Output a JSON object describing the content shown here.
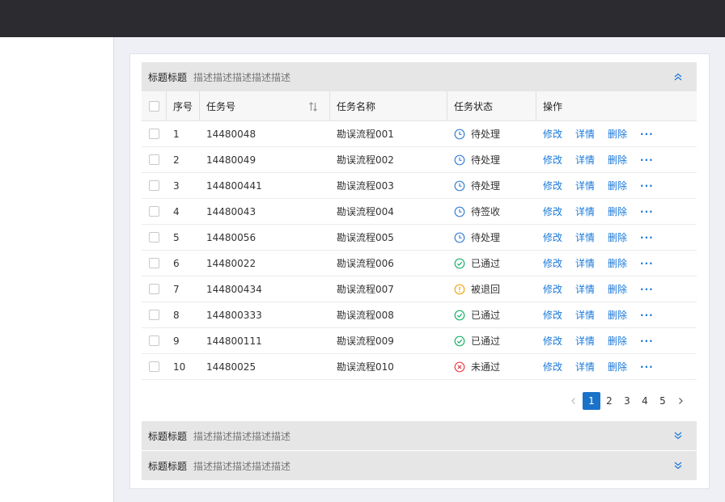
{
  "panels": [
    {
      "title": "标题标题",
      "desc": "描述描述描述描述描述",
      "expanded": true,
      "chevron": "chevron-double-up-icon"
    },
    {
      "title": "标题标题",
      "desc": "描述描述描述描述描述",
      "expanded": false,
      "chevron": "chevron-double-down-icon"
    },
    {
      "title": "标题标题",
      "desc": "描述描述描述描述描述",
      "expanded": false,
      "chevron": "chevron-double-down-icon"
    }
  ],
  "table": {
    "headers": {
      "index": "序号",
      "task_no": "任务号",
      "task_name": "任务名称",
      "status": "任务状态",
      "ops": "操作"
    },
    "rows": [
      {
        "index": "1",
        "task_no": "14480048",
        "task_name": "勘误流程001",
        "status": "待处理",
        "status_icon": "clock-icon"
      },
      {
        "index": "2",
        "task_no": "14480049",
        "task_name": "勘误流程002",
        "status": "待处理",
        "status_icon": "clock-icon"
      },
      {
        "index": "3",
        "task_no": "144800441",
        "task_name": "勘误流程003",
        "status": "待处理",
        "status_icon": "clock-icon"
      },
      {
        "index": "4",
        "task_no": "14480043",
        "task_name": "勘误流程004",
        "status": "待签收",
        "status_icon": "clock-icon"
      },
      {
        "index": "5",
        "task_no": "14480056",
        "task_name": "勘误流程005",
        "status": "待处理",
        "status_icon": "clock-icon"
      },
      {
        "index": "6",
        "task_no": "14480022",
        "task_name": "勘误流程006",
        "status": "已通过",
        "status_icon": "check-circle-icon"
      },
      {
        "index": "7",
        "task_no": "144800434",
        "task_name": "勘误流程007",
        "status": "被退回",
        "status_icon": "warning-circle-icon"
      },
      {
        "index": "8",
        "task_no": "144800333",
        "task_name": "勘误流程008",
        "status": "已通过",
        "status_icon": "check-circle-icon"
      },
      {
        "index": "9",
        "task_no": "144800111",
        "task_name": "勘误流程009",
        "status": "已通过",
        "status_icon": "check-circle-icon"
      },
      {
        "index": "10",
        "task_no": "14480025",
        "task_name": "勘误流程010",
        "status": "未通过",
        "status_icon": "close-circle-icon"
      }
    ],
    "ops": {
      "edit": "修改",
      "detail": "详情",
      "delete": "删除",
      "more": "···"
    }
  },
  "pagination": {
    "pages": [
      "1",
      "2",
      "3",
      "4",
      "5"
    ],
    "current": "1"
  },
  "colors": {
    "topbar": "#2b2b30",
    "link": "#1a78d8",
    "pending": "#3b82d6",
    "passed": "#20b26b",
    "returned": "#f0a814",
    "rejected": "#e8434b",
    "page_active": "#1a72c9"
  }
}
